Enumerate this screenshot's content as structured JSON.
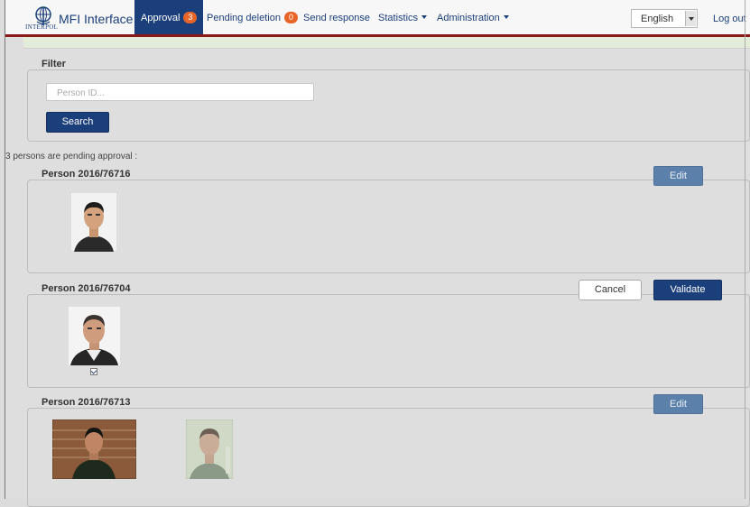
{
  "navbar": {
    "logo_text": "INTERPOL",
    "brand": "MFI Interface",
    "approval_label": "Approval",
    "approval_count": "3",
    "pending_deletion_label": "Pending deletion",
    "pending_deletion_count": "0",
    "send_response_label": "Send response",
    "statistics_label": "Statistics",
    "administration_label": "Administration",
    "language_value": "English",
    "logout_label": "Log out"
  },
  "filter": {
    "legend": "Filter",
    "person_id_placeholder": "Person ID...",
    "person_id_value": "",
    "search_label": "Search"
  },
  "pending_text": "3 persons are pending approval :",
  "persons": [
    {
      "legend": "Person 2016/76716",
      "edit_label": "Edit"
    },
    {
      "legend": "Person 2016/76704",
      "cancel_label": "Cancel",
      "validate_label": "Validate",
      "photo_checked": true
    },
    {
      "legend": "Person 2016/76713",
      "edit_label": "Edit"
    }
  ],
  "colors": {
    "navbar_accent": "#1b3f7a",
    "badge": "#e8652a",
    "navbar_border": "#8b1a1a",
    "edit_button": "#5b80aa"
  }
}
